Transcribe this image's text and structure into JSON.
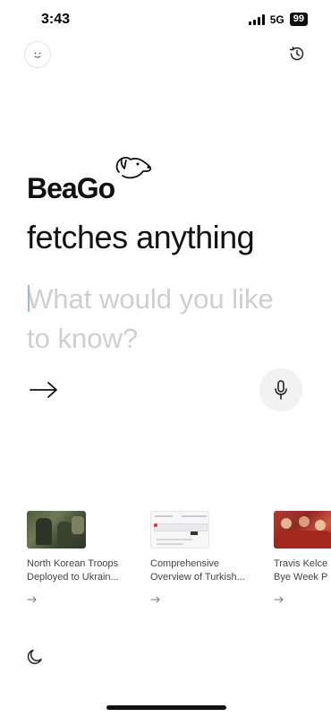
{
  "status_bar": {
    "time": "3:43",
    "network": "5G",
    "battery": "99"
  },
  "header": {
    "left_icon": "smiley-face-icon",
    "right_icon": "history-icon"
  },
  "brand": {
    "name": "BeaGo",
    "logo_icon": "dog-head-icon"
  },
  "tagline": "fetches anything",
  "search": {
    "placeholder": "What would you like to know?",
    "value": ""
  },
  "actions": {
    "submit_icon": "arrow-right-icon",
    "voice_icon": "microphone-icon"
  },
  "cards": [
    {
      "line1": "North Korean Troops",
      "line2": "Deployed to Ukrain...",
      "thumb": "soldiers-photo"
    },
    {
      "line1": "Comprehensive",
      "line2": "Overview of Turkish...",
      "thumb": "webpage-screenshot"
    },
    {
      "line1": "Travis Kelce",
      "line2": "Bye Week P",
      "thumb": "crowd-photo"
    }
  ],
  "footer": {
    "theme_icon": "moon-icon"
  }
}
